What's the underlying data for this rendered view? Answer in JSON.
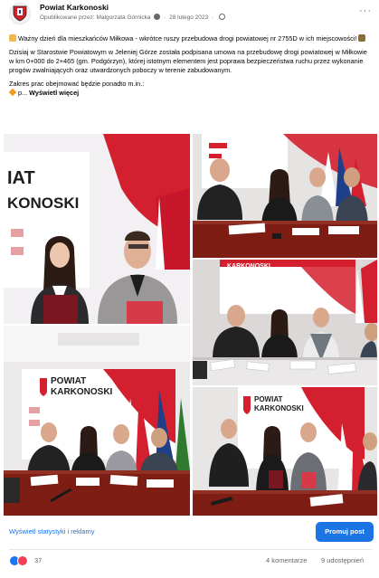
{
  "post": {
    "page_name": "Powiat Karkonoski",
    "byline_published": "Opublikowane przez: Małgorzata Górnicka",
    "byline_date": "28 lutego 2023",
    "more_icon": "···",
    "paragraph1": "Ważny dzień dla mieszkańców Miłkowa - wkrótce ruszy przebudowa drogi powiatowej nr 2755D w ich miejscowości!",
    "paragraph2": "Dzisiaj w Starostwie Powiatowym w Jeleniej Górze została podpisana umowa na przebudowę drogi powiatowej w Miłkowie w km 0+000 do 2+465 (gm. Podgórzyn), której istotnym elementem jest poprawa bezpieczeństwa ruchu przez wykonanie progów zwalniających oraz utwardzonych poboczy w terenie zabudowanym.",
    "paragraph3": "Zakres prac obejmować będzie ponadto m.in.:",
    "truncated": "p...",
    "see_more": "Wyświetl więcej"
  },
  "banner": {
    "brand_top": "POWIAT",
    "brand_bottom": "KARKONOSKI",
    "closeup_top": "IAT",
    "closeup_bottom": "KONOSKI"
  },
  "footer": {
    "stats_link": "Wyświetl statystyki i reklamy",
    "promote_button": "Promuj post",
    "reaction_count": "37",
    "comments": "4 komentarze",
    "shares": "9 udostępnień"
  },
  "colors": {
    "accent_blue": "#1b74e4",
    "like_blue": "#1877f2",
    "love_red": "#f33e58",
    "banner_red": "#d4202e",
    "muted_text": "#65676b"
  },
  "icons": [
    "coat-of-arms-icon",
    "globe-icon",
    "more-icon",
    "like-reaction-icon",
    "love-reaction-icon",
    "hand-emoji-icon",
    "road-emoji-icon",
    "pen-emoji-icon",
    "orange-diamond-icon"
  ]
}
